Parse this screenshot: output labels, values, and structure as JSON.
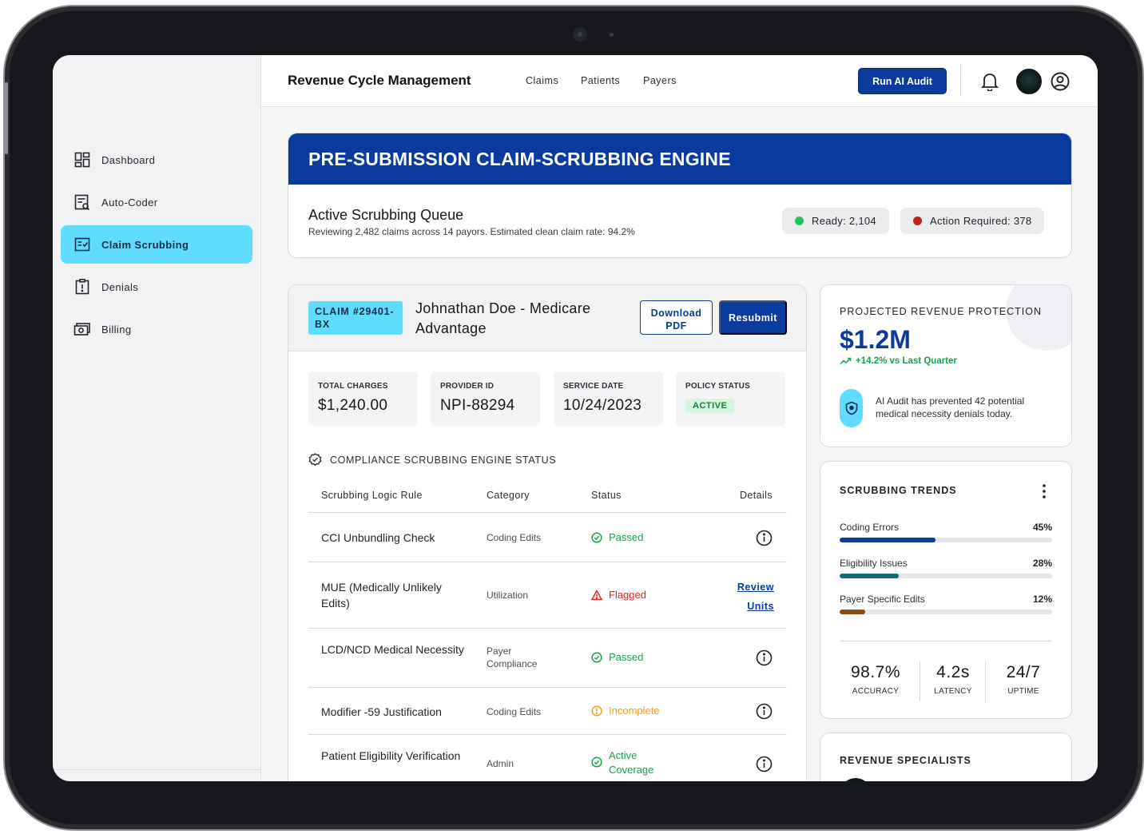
{
  "header": {
    "brand": "Revenue Cycle Management",
    "nav": [
      "Claims",
      "Patients",
      "Payers"
    ],
    "run_audit_label": "Run AI Audit"
  },
  "sidebar": {
    "items": [
      {
        "label": "Dashboard",
        "icon": "dashboard-icon",
        "active": false
      },
      {
        "label": "Auto-Coder",
        "icon": "auto-coder-icon",
        "active": false
      },
      {
        "label": "Claim Scrubbing",
        "icon": "claim-scrubbing-icon",
        "active": true
      },
      {
        "label": "Denials",
        "icon": "denials-icon",
        "active": false
      },
      {
        "label": "Billing",
        "icon": "billing-icon",
        "active": false
      }
    ]
  },
  "hero": {
    "title": "PRE-SUBMISSION CLAIM-SCRUBBING ENGINE",
    "queue_title": "Active Scrubbing Queue",
    "queue_subtitle": "Reviewing 2,482 claims across 14 payors. Estimated clean claim rate: 94.2%",
    "ready_label": "Ready: 2,104",
    "action_label": "Action Required: 378"
  },
  "claim": {
    "tag": "CLAIM #29401-BX",
    "patient": "Johnathan Doe - Medicare Advantage",
    "download_label": "Download PDF",
    "resubmit_label": "Resubmit",
    "stats": [
      {
        "label": "TOTAL CHARGES",
        "value": "$1,240.00"
      },
      {
        "label": "PROVIDER ID",
        "value": "NPI-88294"
      },
      {
        "label": "SERVICE DATE",
        "value": "10/24/2023"
      },
      {
        "label": "POLICY STATUS",
        "value": "ACTIVE"
      }
    ],
    "compliance_title": "COMPLIANCE SCRUBBING ENGINE STATUS",
    "columns": [
      "Scrubbing Logic Rule",
      "Category",
      "Status",
      "Details"
    ],
    "rows": [
      {
        "rule": "CCI Unbundling Check",
        "category": "Coding Edits",
        "status": "Passed",
        "state": "pass"
      },
      {
        "rule": "MUE (Medically Unlikely Edits)",
        "category": "Utilization",
        "status": "Flagged",
        "state": "flag",
        "link": "Review Units"
      },
      {
        "rule": "LCD/NCD Medical Necessity",
        "category": "Payer Compliance",
        "status": "Passed",
        "state": "pass"
      },
      {
        "rule": "Modifier -59 Justification",
        "category": "Coding Edits",
        "status": "Incomplete",
        "state": "warn"
      },
      {
        "rule": "Patient Eligibility Verification",
        "category": "Admin",
        "status": "Active Coverage",
        "state": "pass"
      }
    ]
  },
  "revenue": {
    "title": "PROJECTED REVENUE PROTECTION",
    "value": "$1.2M",
    "change": "+14.2% vs Last Quarter",
    "note": "AI Audit has prevented 42 potential medical necessity denials today."
  },
  "trends": {
    "title": "SCRUBBING TRENDS",
    "items": [
      {
        "label": "Coding Errors",
        "pct": "45%",
        "value": 0.45,
        "color": "#0a3a9c"
      },
      {
        "label": "Eligibility Issues",
        "pct": "28%",
        "value": 0.28,
        "color": "#0f6e7a"
      },
      {
        "label": "Payer Specific Edits",
        "pct": "12%",
        "value": 0.12,
        "color": "#8a4a0f"
      }
    ],
    "metrics": [
      {
        "value": "98.7%",
        "label": "ACCURACY"
      },
      {
        "value": "4.2s",
        "label": "LATENCY"
      },
      {
        "value": "24/7",
        "label": "UPTIME"
      }
    ]
  },
  "specialists": {
    "title": "REVENUE SPECIALISTS"
  },
  "colors": {
    "brand_blue": "#0a3a9c",
    "accent_cyan": "#5fdcff",
    "success": "#16a34a",
    "danger": "#dc2626",
    "warning": "#f59e0b"
  }
}
